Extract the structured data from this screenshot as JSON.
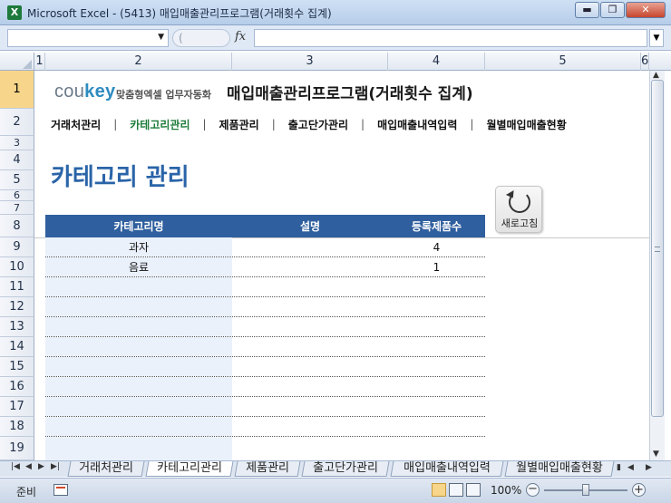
{
  "window": {
    "app_icon": "X",
    "title": "Microsoft Excel - (5413) 매입매출관리프로그램(거래횟수 집계)",
    "minimize": "▬",
    "maximize": "❐",
    "close": "✕"
  },
  "formula_bar": {
    "name_box": "",
    "fx": "fx",
    "cancel_hint": "(",
    "formula": ""
  },
  "columns": [
    "1",
    "2",
    "3",
    "4",
    "5",
    "6"
  ],
  "rows": [
    "1",
    "2",
    "3",
    "4",
    "5",
    "6",
    "7",
    "8",
    "9",
    "10",
    "11",
    "12",
    "13",
    "14",
    "15",
    "16",
    "17",
    "18",
    "19"
  ],
  "selected_row": "1",
  "header": {
    "brand_prefix": "cou",
    "brand_key": "key",
    "brand_sub": "맞춤형엑셀 업무자동화",
    "title": "매입매출관리프로그램(거래횟수 집계)"
  },
  "nav": {
    "items": [
      "거래처관리",
      "카테고리관리",
      "제품관리",
      "출고단가관리",
      "매입매출내역입력",
      "월별매입매출현황"
    ],
    "active_index": 1,
    "separator": "|"
  },
  "page_title": "카테고리 관리",
  "refresh_button": {
    "label": "새로고침"
  },
  "table": {
    "columns": [
      "카테고리명",
      "설명",
      "등록제품수"
    ],
    "rows": [
      [
        "과자",
        "",
        "4"
      ],
      [
        "음료",
        "",
        "1"
      ],
      [
        "",
        "",
        ""
      ],
      [
        "",
        "",
        ""
      ],
      [
        "",
        "",
        ""
      ],
      [
        "",
        "",
        ""
      ],
      [
        "",
        "",
        ""
      ],
      [
        "",
        "",
        ""
      ],
      [
        "",
        "",
        ""
      ],
      [
        "",
        "",
        ""
      ]
    ]
  },
  "sheet_tabs": {
    "tabs": [
      "거래처관리",
      "카테고리관리",
      "제품관리",
      "출고단가관리",
      "매입매출내역입력",
      "월별매입매출현황"
    ],
    "active_index": 1
  },
  "status_bar": {
    "status": "준비",
    "zoom": "100%",
    "zoom_level_percent": 100
  },
  "colors": {
    "accent_blue": "#2a64a8",
    "table_header": "#2f5f9e",
    "active_nav": "#1e7c3a",
    "selected_row_header": "#f7d58a"
  }
}
